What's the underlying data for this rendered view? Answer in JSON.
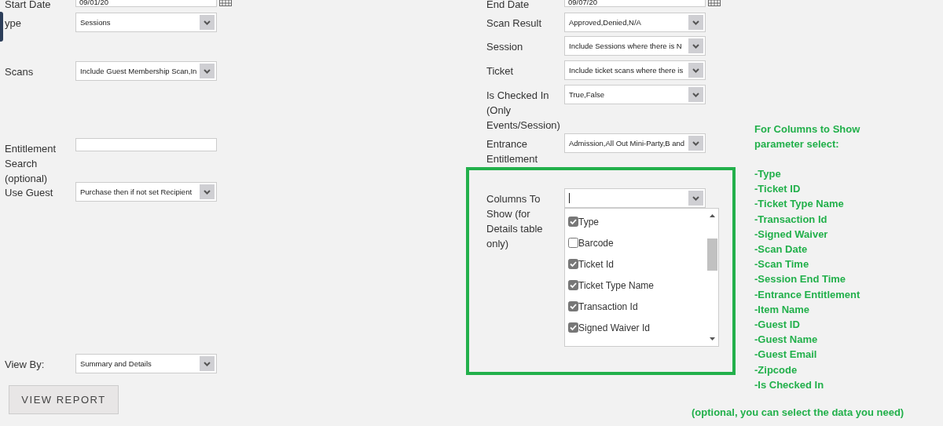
{
  "left_fields": [
    {
      "label": "Start Date",
      "kind": "date",
      "value": "09/01/20"
    },
    {
      "label": "ype",
      "kind": "select",
      "value": "Sessions"
    },
    {
      "label": "Scans",
      "kind": "select",
      "value": "Include Guest Membership Scan,In"
    },
    {
      "label": "Entitlement Search (optional)",
      "kind": "text"
    },
    {
      "label": "Use Guest",
      "kind": "select",
      "value": "Purchase then if not set Recipient"
    },
    {
      "label": "View By:",
      "kind": "select",
      "value": "Summary and Details"
    }
  ],
  "view_report_button": "VIEW REPORT",
  "right_fields": [
    {
      "label": "End Date",
      "kind": "date",
      "value": "09/07/20"
    },
    {
      "label": "Scan Result",
      "kind": "select",
      "value": "Approved,Denied,N/A"
    },
    {
      "label": "Session",
      "kind": "select",
      "value": "Include Sessions where there is N"
    },
    {
      "label": "Ticket",
      "kind": "select",
      "value": "Include ticket scans where there is"
    },
    {
      "label": "Is Checked In (Only Events/Session)",
      "kind": "select",
      "value": "True,False"
    },
    {
      "label": "Entrance Entitlement",
      "kind": "select",
      "value": "Admission,All Out Mini-Party,B and"
    }
  ],
  "columns_to_show": {
    "label": "Columns To Show (for Details table only)",
    "options": [
      {
        "label": "Type",
        "checked": true
      },
      {
        "label": "Barcode",
        "checked": false
      },
      {
        "label": "Ticket Id",
        "checked": true
      },
      {
        "label": "Ticket Type Name",
        "checked": true
      },
      {
        "label": "Transaction Id",
        "checked": true
      },
      {
        "label": "Signed Waiver Id",
        "checked": true
      }
    ]
  },
  "note": {
    "heading": "For Columns to Show parameter select:",
    "items": [
      "-Type",
      "-Ticket ID",
      "-Ticket Type Name",
      "-Transaction Id",
      "-Signed Waiver",
      "-Scan Date",
      "-Scan Time",
      "-Session End Time",
      "-Entrance Entitlement",
      "-Item Name",
      "-Guest ID",
      "-Guest Name",
      "-Guest Email",
      "-Zipcode",
      "-Is Checked In"
    ],
    "footer": "(optional, you can select the data you need)"
  }
}
